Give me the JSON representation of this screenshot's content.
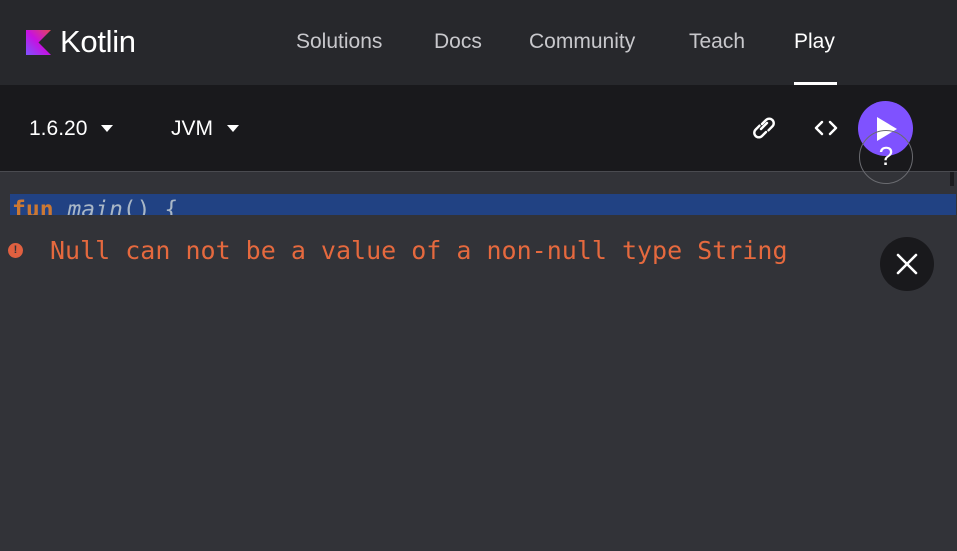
{
  "brand": {
    "name": "Kotlin"
  },
  "nav": {
    "items": [
      {
        "label": "Solutions"
      },
      {
        "label": "Docs"
      },
      {
        "label": "Community"
      },
      {
        "label": "Teach"
      },
      {
        "label": "Play"
      }
    ],
    "active": "Play"
  },
  "toolbar": {
    "version": "1.6.20",
    "target": "JVM",
    "icons": [
      "link-icon",
      "code-brackets-icon",
      "play-icon",
      "question-icon"
    ],
    "help_label": "?"
  },
  "editor": {
    "keyword": "fun",
    "function_name": "main",
    "rest": "() {"
  },
  "error": {
    "message": "Null can not be a value of a non-null type String",
    "icon_label": "!"
  },
  "colors": {
    "accent": "#7f52ff",
    "error": "#e5693e",
    "nav_bg": "#27282c",
    "toolbar_bg": "#19191c",
    "panel_bg": "#323338",
    "selection": "#214283"
  }
}
